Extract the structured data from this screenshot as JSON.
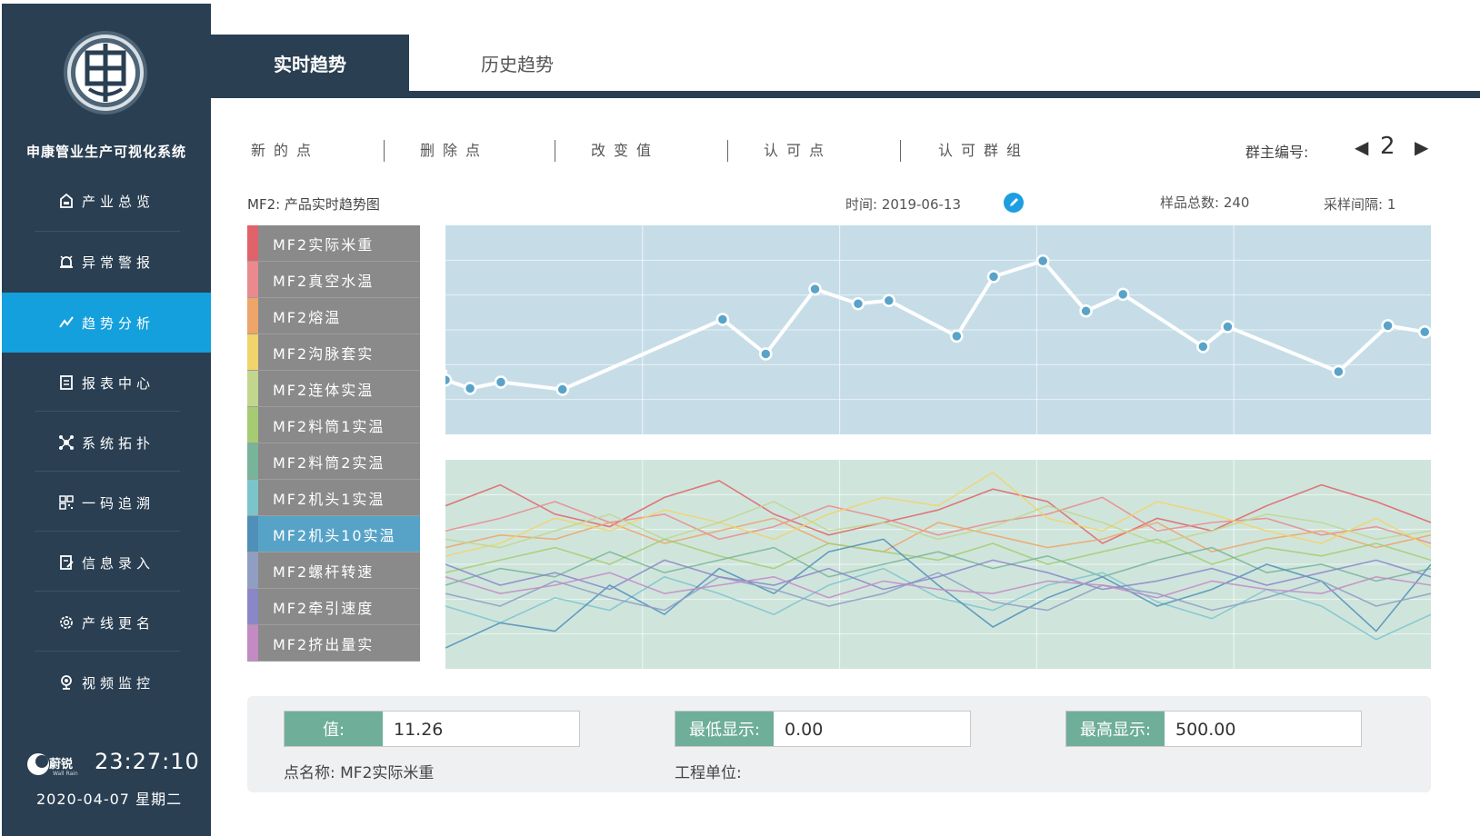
{
  "app": {
    "title": "申康管业生产可视化系统"
  },
  "sidebar": {
    "items": [
      {
        "label": "产业总览",
        "icon": "home-icon",
        "active": false
      },
      {
        "label": "异常警报",
        "icon": "alarm-icon",
        "active": false
      },
      {
        "label": "趋势分析",
        "icon": "trend-icon",
        "active": true
      },
      {
        "label": "报表中心",
        "icon": "report-icon",
        "active": false
      },
      {
        "label": "系统拓扑",
        "icon": "topology-icon",
        "active": false
      },
      {
        "label": "一码追溯",
        "icon": "qrcode-icon",
        "active": false
      },
      {
        "label": "信息录入",
        "icon": "edit-icon",
        "active": false
      },
      {
        "label": "产线更名",
        "icon": "settings-icon",
        "active": false
      },
      {
        "label": "视频监控",
        "icon": "camera-icon",
        "active": false
      }
    ],
    "brand": {
      "name": "蔚锐",
      "sub": "Wall Rain"
    },
    "clock": {
      "time": "23:27:10",
      "date": "2020-04-07 星期二"
    }
  },
  "tabs": {
    "realtime": "实时趋势",
    "history": "历史趋势"
  },
  "toolbar": {
    "buttons": [
      "新的点",
      "删除点",
      "改变值",
      "认可点",
      "认可群组"
    ],
    "group_label": "群主编号:",
    "group_number": "2"
  },
  "info": {
    "chart_title": "MF2: 产品实时趋势图",
    "time": "时间: 2019-06-13",
    "sample_total": "样品总数: 240",
    "sample_interval": "采样间隔: 1"
  },
  "legend": [
    {
      "label": "MF2实际米重",
      "color": "#e0626a",
      "selected": false
    },
    {
      "label": "MF2真空水温",
      "color": "#ea8a8e",
      "selected": false
    },
    {
      "label": "MF2熔温",
      "color": "#eea56a",
      "selected": false
    },
    {
      "label": "MF2沟脉套实",
      "color": "#f1d46a",
      "selected": false
    },
    {
      "label": "MF2连体实温",
      "color": "#c2d68e",
      "selected": false
    },
    {
      "label": "MF2料筒1实温",
      "color": "#a7cb72",
      "selected": false
    },
    {
      "label": "MF2料筒2实温",
      "color": "#78b49a",
      "selected": false
    },
    {
      "label": "MF2机头1实温",
      "color": "#7cc4cc",
      "selected": false
    },
    {
      "label": "MF2机头10实温",
      "color": "#4f8fb8",
      "selected": true
    },
    {
      "label": "MF2螺杆转速",
      "color": "#8f9ec2",
      "selected": false
    },
    {
      "label": "MF2牵引速度",
      "color": "#8a86c8",
      "selected": false
    },
    {
      "label": "MF2挤出量实",
      "color": "#c48ac4",
      "selected": false
    }
  ],
  "chart_data": [
    {
      "type": "line",
      "series": [
        {
          "values": [
            52,
            44,
            50,
            43,
            110,
            77,
            139,
            125,
            128,
            94,
            151,
            166,
            118,
            134,
            84,
            103,
            60,
            104,
            98
          ]
        }
      ],
      "x_positions": [
        0,
        4,
        9,
        19,
        45,
        52,
        60,
        67,
        72,
        83,
        89,
        97,
        104,
        110,
        123,
        127,
        145,
        153,
        159
      ],
      "ylim": [
        0,
        200
      ],
      "grid": true,
      "colors": {
        "background": "#c6dde8",
        "line": "#ffffff",
        "marker": "#5aa3c8"
      }
    },
    {
      "type": "line",
      "grid": true,
      "ylim": [
        0,
        100
      ],
      "colors": {
        "background": "#cfe5dc"
      },
      "series": [
        {
          "color": "#e0626a",
          "values": [
            78,
            88,
            74,
            68,
            82,
            90,
            74,
            64,
            70,
            76,
            86,
            80,
            60,
            72,
            66,
            78,
            88,
            80,
            70
          ]
        },
        {
          "color": "#ea8a8e",
          "values": [
            66,
            72,
            80,
            70,
            74,
            62,
            68,
            78,
            72,
            64,
            70,
            74,
            82,
            66,
            70,
            72,
            64,
            68,
            60
          ]
        },
        {
          "color": "#eea56a",
          "values": [
            58,
            64,
            62,
            70,
            60,
            66,
            72,
            60,
            56,
            70,
            64,
            58,
            62,
            70,
            56,
            62,
            66,
            58,
            64
          ]
        },
        {
          "color": "#f1d46a",
          "values": [
            54,
            60,
            72,
            66,
            76,
            70,
            62,
            74,
            82,
            78,
            94,
            72,
            66,
            80,
            74,
            66,
            60,
            72,
            58
          ]
        },
        {
          "color": "#c2d68e",
          "values": [
            62,
            58,
            66,
            74,
            62,
            70,
            80,
            66,
            70,
            62,
            68,
            78,
            70,
            60,
            66,
            74,
            70,
            62,
            66
          ]
        },
        {
          "color": "#a7cb72",
          "values": [
            46,
            52,
            58,
            50,
            62,
            54,
            48,
            60,
            56,
            52,
            60,
            50,
            56,
            62,
            50,
            58,
            54,
            60,
            52
          ]
        },
        {
          "color": "#78b49a",
          "values": [
            40,
            48,
            44,
            56,
            46,
            52,
            58,
            44,
            50,
            56,
            48,
            54,
            44,
            52,
            58,
            46,
            50,
            42,
            48
          ]
        },
        {
          "color": "#7cc4cc",
          "values": [
            30,
            22,
            34,
            28,
            44,
            36,
            26,
            40,
            48,
            34,
            28,
            40,
            46,
            32,
            24,
            38,
            30,
            14,
            26
          ]
        },
        {
          "color": "#4f8fb8",
          "values": [
            10,
            22,
            18,
            40,
            26,
            48,
            36,
            56,
            62,
            40,
            20,
            34,
            44,
            30,
            38,
            50,
            42,
            18,
            50
          ]
        },
        {
          "color": "#8f9ec2",
          "values": [
            36,
            30,
            42,
            34,
            28,
            44,
            38,
            30,
            36,
            46,
            32,
            28,
            40,
            36,
            28,
            34,
            42,
            30,
            36
          ]
        },
        {
          "color": "#8a86c8",
          "values": [
            50,
            40,
            46,
            38,
            52,
            44,
            40,
            48,
            38,
            44,
            52,
            46,
            38,
            42,
            48,
            40,
            46,
            52,
            44
          ]
        },
        {
          "color": "#c48ac4",
          "values": [
            44,
            36,
            40,
            46,
            36,
            40,
            44,
            34,
            42,
            38,
            36,
            42,
            40,
            34,
            42,
            38,
            36,
            44,
            40
          ]
        }
      ]
    }
  ],
  "panel": {
    "value_label": "值:",
    "value": "11.26",
    "min_label": "最低显示:",
    "min_value": "0.00",
    "max_label": "最高显示:",
    "max_value": "500.00",
    "point_name": "点名称: MF2实际米重",
    "unit": "工程单位:"
  }
}
